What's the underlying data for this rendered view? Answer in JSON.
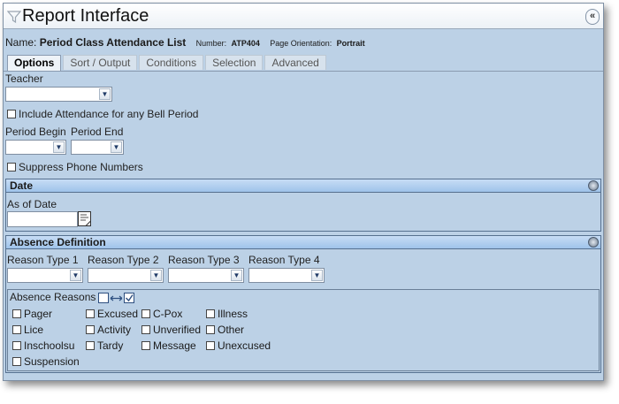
{
  "window": {
    "title": "Report Interface",
    "collapse_glyph": "«"
  },
  "report": {
    "name_label": "Name:",
    "name_value": "Period Class Attendance List",
    "number_label": "Number:",
    "number_value": "ATP404",
    "orientation_label": "Page Orientation:",
    "orientation_value": "Portrait"
  },
  "tabs": [
    {
      "label": "Options",
      "active": true
    },
    {
      "label": "Sort / Output",
      "active": false
    },
    {
      "label": "Conditions",
      "active": false
    },
    {
      "label": "Selection",
      "active": false
    },
    {
      "label": "Advanced",
      "active": false
    }
  ],
  "options": {
    "teacher_label": "Teacher",
    "teacher_value": "",
    "include_attendance_label": "Include Attendance for any Bell Period",
    "period_begin_label": "Period Begin",
    "period_end_label": "Period End",
    "suppress_phone_label": "Suppress Phone Numbers"
  },
  "date_section": {
    "header": "Date",
    "as_of_label": "As of Date",
    "as_of_value": ""
  },
  "absence_section": {
    "header": "Absence Definition",
    "reason_types": [
      {
        "label": "Reason Type 1",
        "value": ""
      },
      {
        "label": "Reason Type 2",
        "value": ""
      },
      {
        "label": "Reason Type 3",
        "value": ""
      },
      {
        "label": "Reason Type 4",
        "value": ""
      }
    ],
    "reasons_label": "Absence Reasons",
    "reasons": [
      "Pager",
      "Excused",
      "C-Pox",
      "Illness",
      "Lice",
      "Activity",
      "Unverified",
      "Other",
      "Inschoolsu",
      "Tardy",
      "Message",
      "Unexcused",
      "Suspension"
    ]
  },
  "icons": {
    "title": "funnel-icon",
    "collapse": "double-chevron-left-icon",
    "section_toggle": "circle-toggle-icon",
    "calendar": "calendar-icon",
    "toggle_all": "toggle-checkboxes-icon",
    "dropdown": "chevron-down-icon"
  },
  "colors": {
    "window_bg": "#bcd1e6",
    "section_header": "#9fc3ea",
    "border": "#56708f"
  }
}
